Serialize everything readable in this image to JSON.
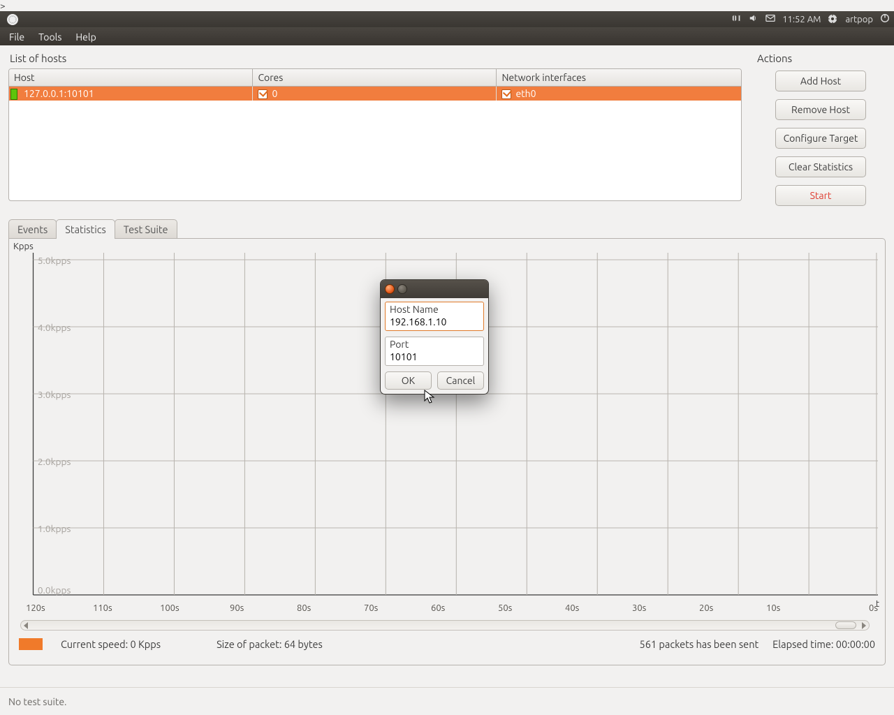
{
  "topbar": {
    "time": "11:52 AM",
    "user": "artpop"
  },
  "menubar": {
    "file": "File",
    "tools": "Tools",
    "help": "Help"
  },
  "hosts": {
    "title": "List of hosts",
    "columns": {
      "host": "Host",
      "cores": "Cores",
      "ifaces": "Network interfaces"
    },
    "rows": [
      {
        "host": "127.0.0.1:10101",
        "core": "0",
        "iface": "eth0"
      }
    ]
  },
  "actions": {
    "title": "Actions",
    "add": "Add Host",
    "remove": "Remove Host",
    "configure": "Configure Target",
    "clear": "Clear Statistics",
    "start": "Start"
  },
  "tabs": {
    "events": "Events",
    "stats": "Statistics",
    "suite": "Test Suite"
  },
  "chart_data": {
    "type": "line",
    "ylabel": "Kpps",
    "xlabel": "t",
    "ylim": [
      0,
      5
    ],
    "yticks": [
      "0.0kpps",
      "1.0kpps",
      "2.0kpps",
      "3.0kpps",
      "4.0kpps",
      "5.0kpps"
    ],
    "xticks": [
      "120s",
      "110s",
      "100s",
      "90s",
      "80s",
      "70s",
      "60s",
      "50s",
      "40s",
      "30s",
      "20s",
      "10s",
      "0s"
    ],
    "series": [
      {
        "name": "Current",
        "values": []
      }
    ]
  },
  "status": {
    "speed_label": "Current speed: 0 Kpps",
    "packet": "Size of packet: 64 bytes",
    "sent": "561 packets has been sent",
    "elapsed": "Elapsed time: 00:00:00"
  },
  "footer": {
    "suite": "No test suite."
  },
  "dialog": {
    "host_label": "Host Name",
    "host_value": "192.168.1.10",
    "port_label": "Port",
    "port_value": "10101",
    "ok": "OK",
    "cancel": "Cancel"
  }
}
